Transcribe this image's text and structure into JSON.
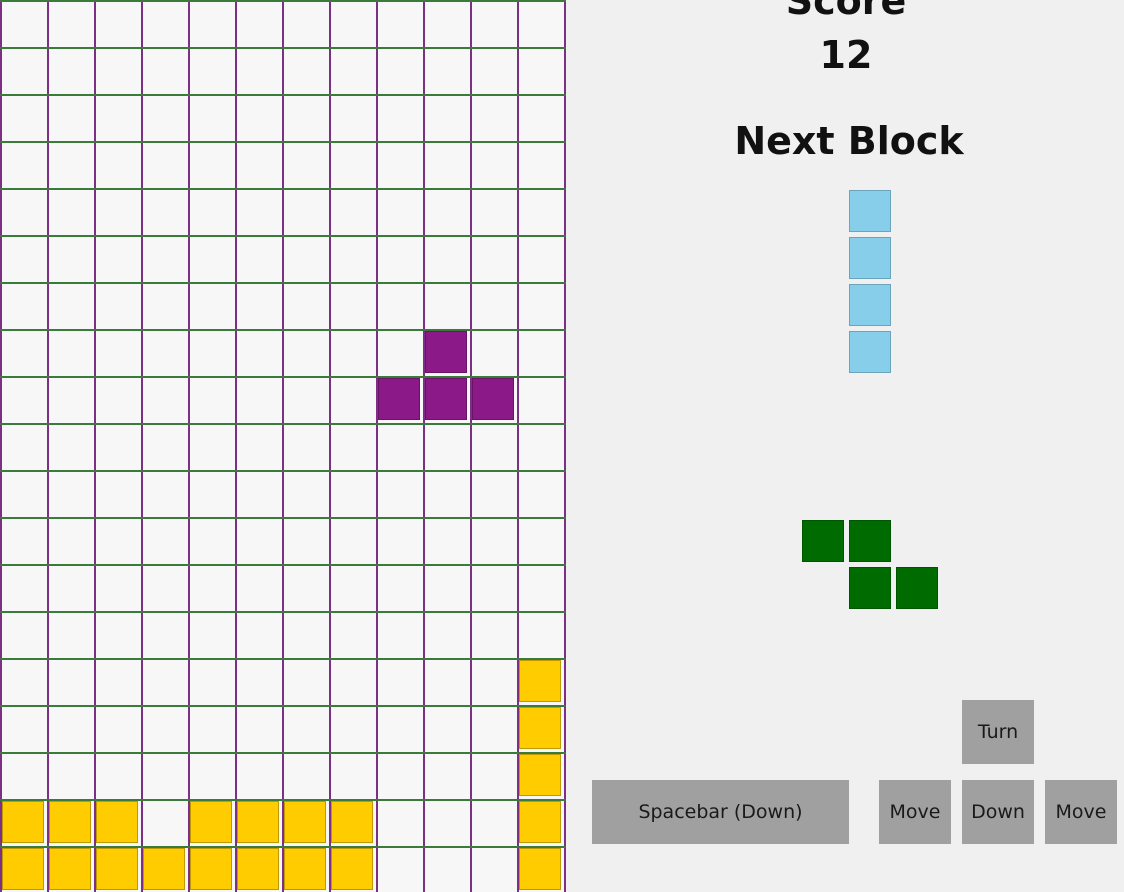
{
  "colors": {
    "purple_piece": "#8b1a88",
    "yellow_piece": "#ffcc00",
    "blue_piece": "#87ceeb",
    "green_piece": "#006b00",
    "grid_vertical": "#7d2f86",
    "grid_horizontal": "#3c7a3c",
    "button": "#a0a0a0"
  },
  "scoreboard": {
    "score_label": "Score",
    "score_value": "12",
    "next_label": "Next Block"
  },
  "board": {
    "columns": 12,
    "rows": 19,
    "falling_piece": {
      "shape": "T",
      "color": "purple_piece",
      "cells": [
        [
          9,
          7
        ],
        [
          8,
          8
        ],
        [
          9,
          8
        ],
        [
          10,
          8
        ]
      ]
    },
    "locked_cells": [
      {
        "col": 11,
        "row": 14,
        "color": "yellow_piece"
      },
      {
        "col": 11,
        "row": 15,
        "color": "yellow_piece"
      },
      {
        "col": 11,
        "row": 16,
        "color": "yellow_piece"
      },
      {
        "col": 11,
        "row": 17,
        "color": "yellow_piece"
      },
      {
        "col": 11,
        "row": 18,
        "color": "yellow_piece"
      },
      {
        "col": 0,
        "row": 17,
        "color": "yellow_piece"
      },
      {
        "col": 1,
        "row": 17,
        "color": "yellow_piece"
      },
      {
        "col": 2,
        "row": 17,
        "color": "yellow_piece"
      },
      {
        "col": 4,
        "row": 17,
        "color": "yellow_piece"
      },
      {
        "col": 5,
        "row": 17,
        "color": "yellow_piece"
      },
      {
        "col": 6,
        "row": 17,
        "color": "yellow_piece"
      },
      {
        "col": 7,
        "row": 17,
        "color": "yellow_piece"
      },
      {
        "col": 0,
        "row": 18,
        "color": "yellow_piece"
      },
      {
        "col": 1,
        "row": 18,
        "color": "yellow_piece"
      },
      {
        "col": 2,
        "row": 18,
        "color": "yellow_piece"
      },
      {
        "col": 3,
        "row": 18,
        "color": "yellow_piece"
      },
      {
        "col": 4,
        "row": 18,
        "color": "yellow_piece"
      },
      {
        "col": 5,
        "row": 18,
        "color": "yellow_piece"
      },
      {
        "col": 6,
        "row": 18,
        "color": "yellow_piece"
      },
      {
        "col": 7,
        "row": 18,
        "color": "yellow_piece"
      }
    ]
  },
  "next_block": {
    "shape": "I",
    "color": "blue_piece"
  },
  "second_preview": {
    "shape": "Z",
    "color": "green_piece"
  },
  "controls": {
    "spacebar_label": "Spacebar (Down)",
    "turn_label": "Turn",
    "move_left_label": "Move",
    "down_label": "Down",
    "move_right_label": "Move"
  }
}
